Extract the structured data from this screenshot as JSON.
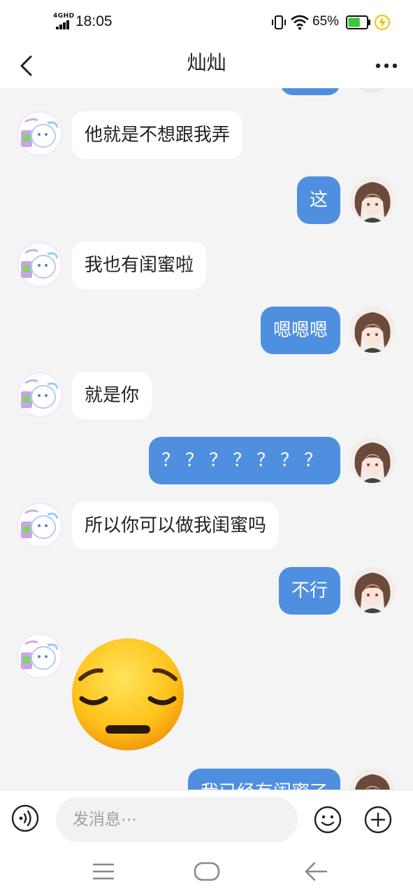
{
  "status_bar": {
    "network_type": "4GHD",
    "time": "18:05",
    "battery_percent": "65%",
    "battery_level": 0.65,
    "icons": [
      "signal-icon",
      "vibrate-icon",
      "wifi-icon",
      "battery-icon",
      "charging-icon"
    ]
  },
  "header": {
    "title": "灿灿",
    "back_icon": "chevron-left-icon",
    "more_icon": "more-dots-icon"
  },
  "messages": [
    {
      "side": "left",
      "type": "text",
      "text": "他就是不想跟我弄"
    },
    {
      "side": "right",
      "type": "text",
      "text": "这"
    },
    {
      "side": "left",
      "type": "text",
      "text": "我也有闺蜜啦"
    },
    {
      "side": "right",
      "type": "text",
      "text": "嗯嗯嗯"
    },
    {
      "side": "left",
      "type": "text",
      "text": "就是你"
    },
    {
      "side": "right",
      "type": "text",
      "text": "？？？？？？？"
    },
    {
      "side": "left",
      "type": "text",
      "text": "所以你可以做我闺蜜吗"
    },
    {
      "side": "right",
      "type": "text",
      "text": "不行"
    },
    {
      "side": "left",
      "type": "sticker",
      "sticker": "pensive-face-emoji"
    },
    {
      "side": "right",
      "type": "text",
      "text": "我已经有闺蜜了"
    }
  ],
  "input_bar": {
    "placeholder": "发消息⋯",
    "voice_icon": "voice-icon",
    "emoji_icon": "emoji-icon",
    "plus_icon": "plus-icon"
  },
  "nav_bar": {
    "icons": [
      "menu-icon",
      "home-icon",
      "back-arrow-icon"
    ]
  },
  "colors": {
    "outgoing_bubble": "#4f8fe0",
    "incoming_bubble": "#ffffff",
    "chat_background": "#f4f4f4",
    "battery_fill": "#3cc63c",
    "charge_bolt": "#f2c200"
  }
}
